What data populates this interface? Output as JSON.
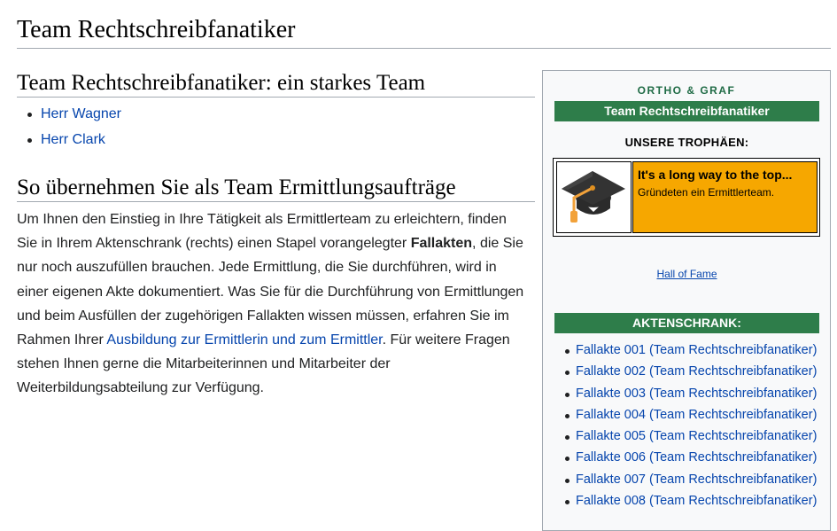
{
  "page": {
    "title": "Team Rechtschreibfanatiker"
  },
  "team_section": {
    "heading": "Team Rechtschreibfanatiker: ein starkes Team",
    "members": [
      {
        "label": "Herr Wagner"
      },
      {
        "label": "Herr Clark"
      }
    ]
  },
  "assignments_section": {
    "heading": "So übernehmen Sie als Team Ermittlungsaufträge",
    "text_1": "Um Ihnen den Einstieg in Ihre Tätigkeit als Ermittlerteam zu erleichtern, finden Sie in Ihrem Aktenschrank (rechts) einen Stapel vorangelegter ",
    "text_bold": "Fallakten",
    "text_2": ", die Sie nur noch auszufüllen brauchen. Jede Ermittlung, die Sie durchführen, wird in einer eigenen Akte dokumentiert. Was Sie für die Durchführung von Ermittlungen und beim Ausfüllen der zugehörigen Fallakten wissen müssen, erfahren Sie im Rahmen Ihrer ",
    "training_link": "Ausbildung zur Ermittlerin und zum Ermittler",
    "text_3": ". Für weitere Fragen stehen Ihnen gerne die Mitarbeiterinnen und Mitarbeiter der Weiterbildungsabteilung zur Verfügung."
  },
  "sidebar": {
    "brand": "ORTHO & GRAF",
    "team_name": "Team Rechtschreibfanatiker",
    "trophies_heading": "UNSERE TROPHÄEN:",
    "trophy": {
      "icon": "graduation-cap-icon",
      "title": "It's a long way to the top...",
      "description": "Gründeten ein Ermittlerteam.",
      "background_color": "#f6a700"
    },
    "hall_of_fame": "Hall of Fame",
    "cabinet_heading": "AKTENSCHRANK:",
    "accent_color": "#2e7d4a",
    "files": [
      {
        "label": "Fallakte 001 (Team Rechtschreibfanatiker)"
      },
      {
        "label": "Fallakte 002 (Team Rechtschreibfanatiker)"
      },
      {
        "label": "Fallakte 003 (Team Rechtschreibfanatiker)"
      },
      {
        "label": "Fallakte 004 (Team Rechtschreibfanatiker)"
      },
      {
        "label": "Fallakte 005 (Team Rechtschreibfanatiker)"
      },
      {
        "label": "Fallakte 006 (Team Rechtschreibfanatiker)"
      },
      {
        "label": "Fallakte 007 (Team Rechtschreibfanatiker)"
      },
      {
        "label": "Fallakte 008 (Team Rechtschreibfanatiker)"
      }
    ]
  }
}
